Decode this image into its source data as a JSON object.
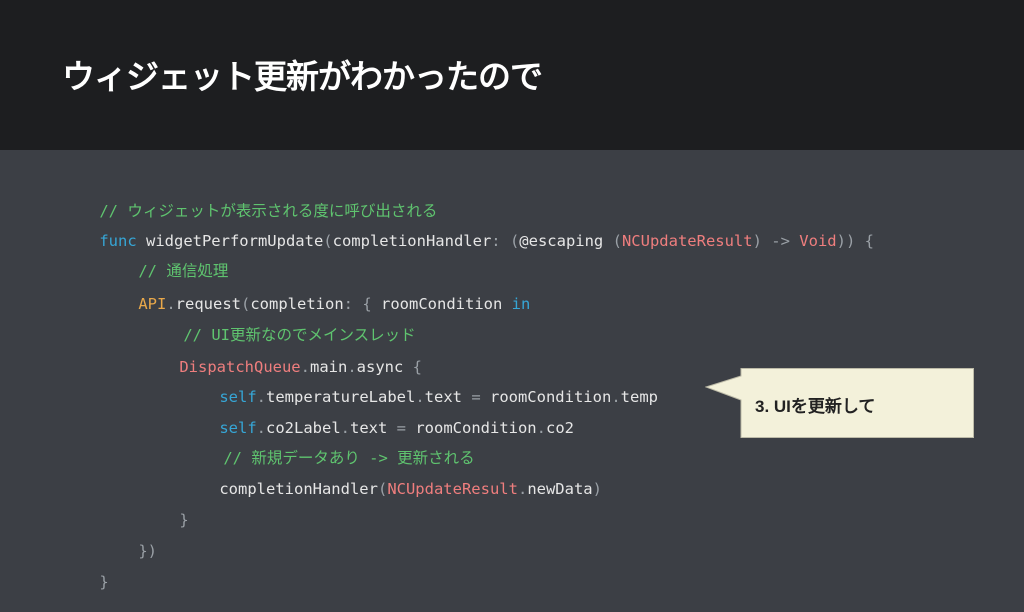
{
  "slide": {
    "title": "ウィジェット更新がわかったので"
  },
  "code": {
    "l1": {
      "comment": "// ウィジェットが表示される度に呼び出される"
    },
    "l2": {
      "t1": "func",
      "t2": " widgetPerformUpdate",
      "t3": "(",
      "t4": "completionHandler",
      "t5": ": (",
      "t6": "@escaping",
      "t7": " (",
      "t8": "NCUpdateResult",
      "t9": ") -> ",
      "t10": "Void",
      "t11": ")) {"
    },
    "l3": {
      "comment": "// 通信処理"
    },
    "l4": {
      "t1": "API",
      "t2": ".",
      "t3": "request",
      "t4": "(",
      "t5": "completion",
      "t6": ": { ",
      "t7": "roomCondition",
      "t8": " in"
    },
    "l5": {
      "comment": "// UI更新なのでメインスレッド"
    },
    "l6": {
      "t1": "DispatchQueue",
      "t2": ".",
      "t3": "main",
      "t4": ".",
      "t5": "async",
      "t6": " {"
    },
    "l7": {
      "t1": "self",
      "t2": ".",
      "t3": "temperatureLabel",
      "t4": ".",
      "t5": "text",
      "t6": " = ",
      "t7": "roomCondition",
      "t8": ".",
      "t9": "temp"
    },
    "l8": {
      "t1": "self",
      "t2": ".",
      "t3": "co2Label",
      "t4": ".",
      "t5": "text",
      "t6": " = ",
      "t7": "roomCondition",
      "t8": ".",
      "t9": "co2"
    },
    "l9": {
      "comment": "// 新規データあり -> 更新される"
    },
    "l10": {
      "t1": "completionHandler",
      "t2": "(",
      "t3": "NCUpdateResult",
      "t4": ".",
      "t5": "newData",
      "t6": ")"
    },
    "l11": {
      "t1": "}"
    },
    "l12": {
      "t1": "})"
    },
    "l13": {
      "t1": "}"
    }
  },
  "callout": {
    "text": "3. UIを更新して",
    "fill": "#f3f1da",
    "border": "#bdbba8"
  },
  "colors": {
    "background": "#3c3f45",
    "header": "#1d1e20",
    "comment": "#5fc46f",
    "keyword": "#e9a84a",
    "type": "#ef7e7e",
    "property": "#36a6d6"
  }
}
